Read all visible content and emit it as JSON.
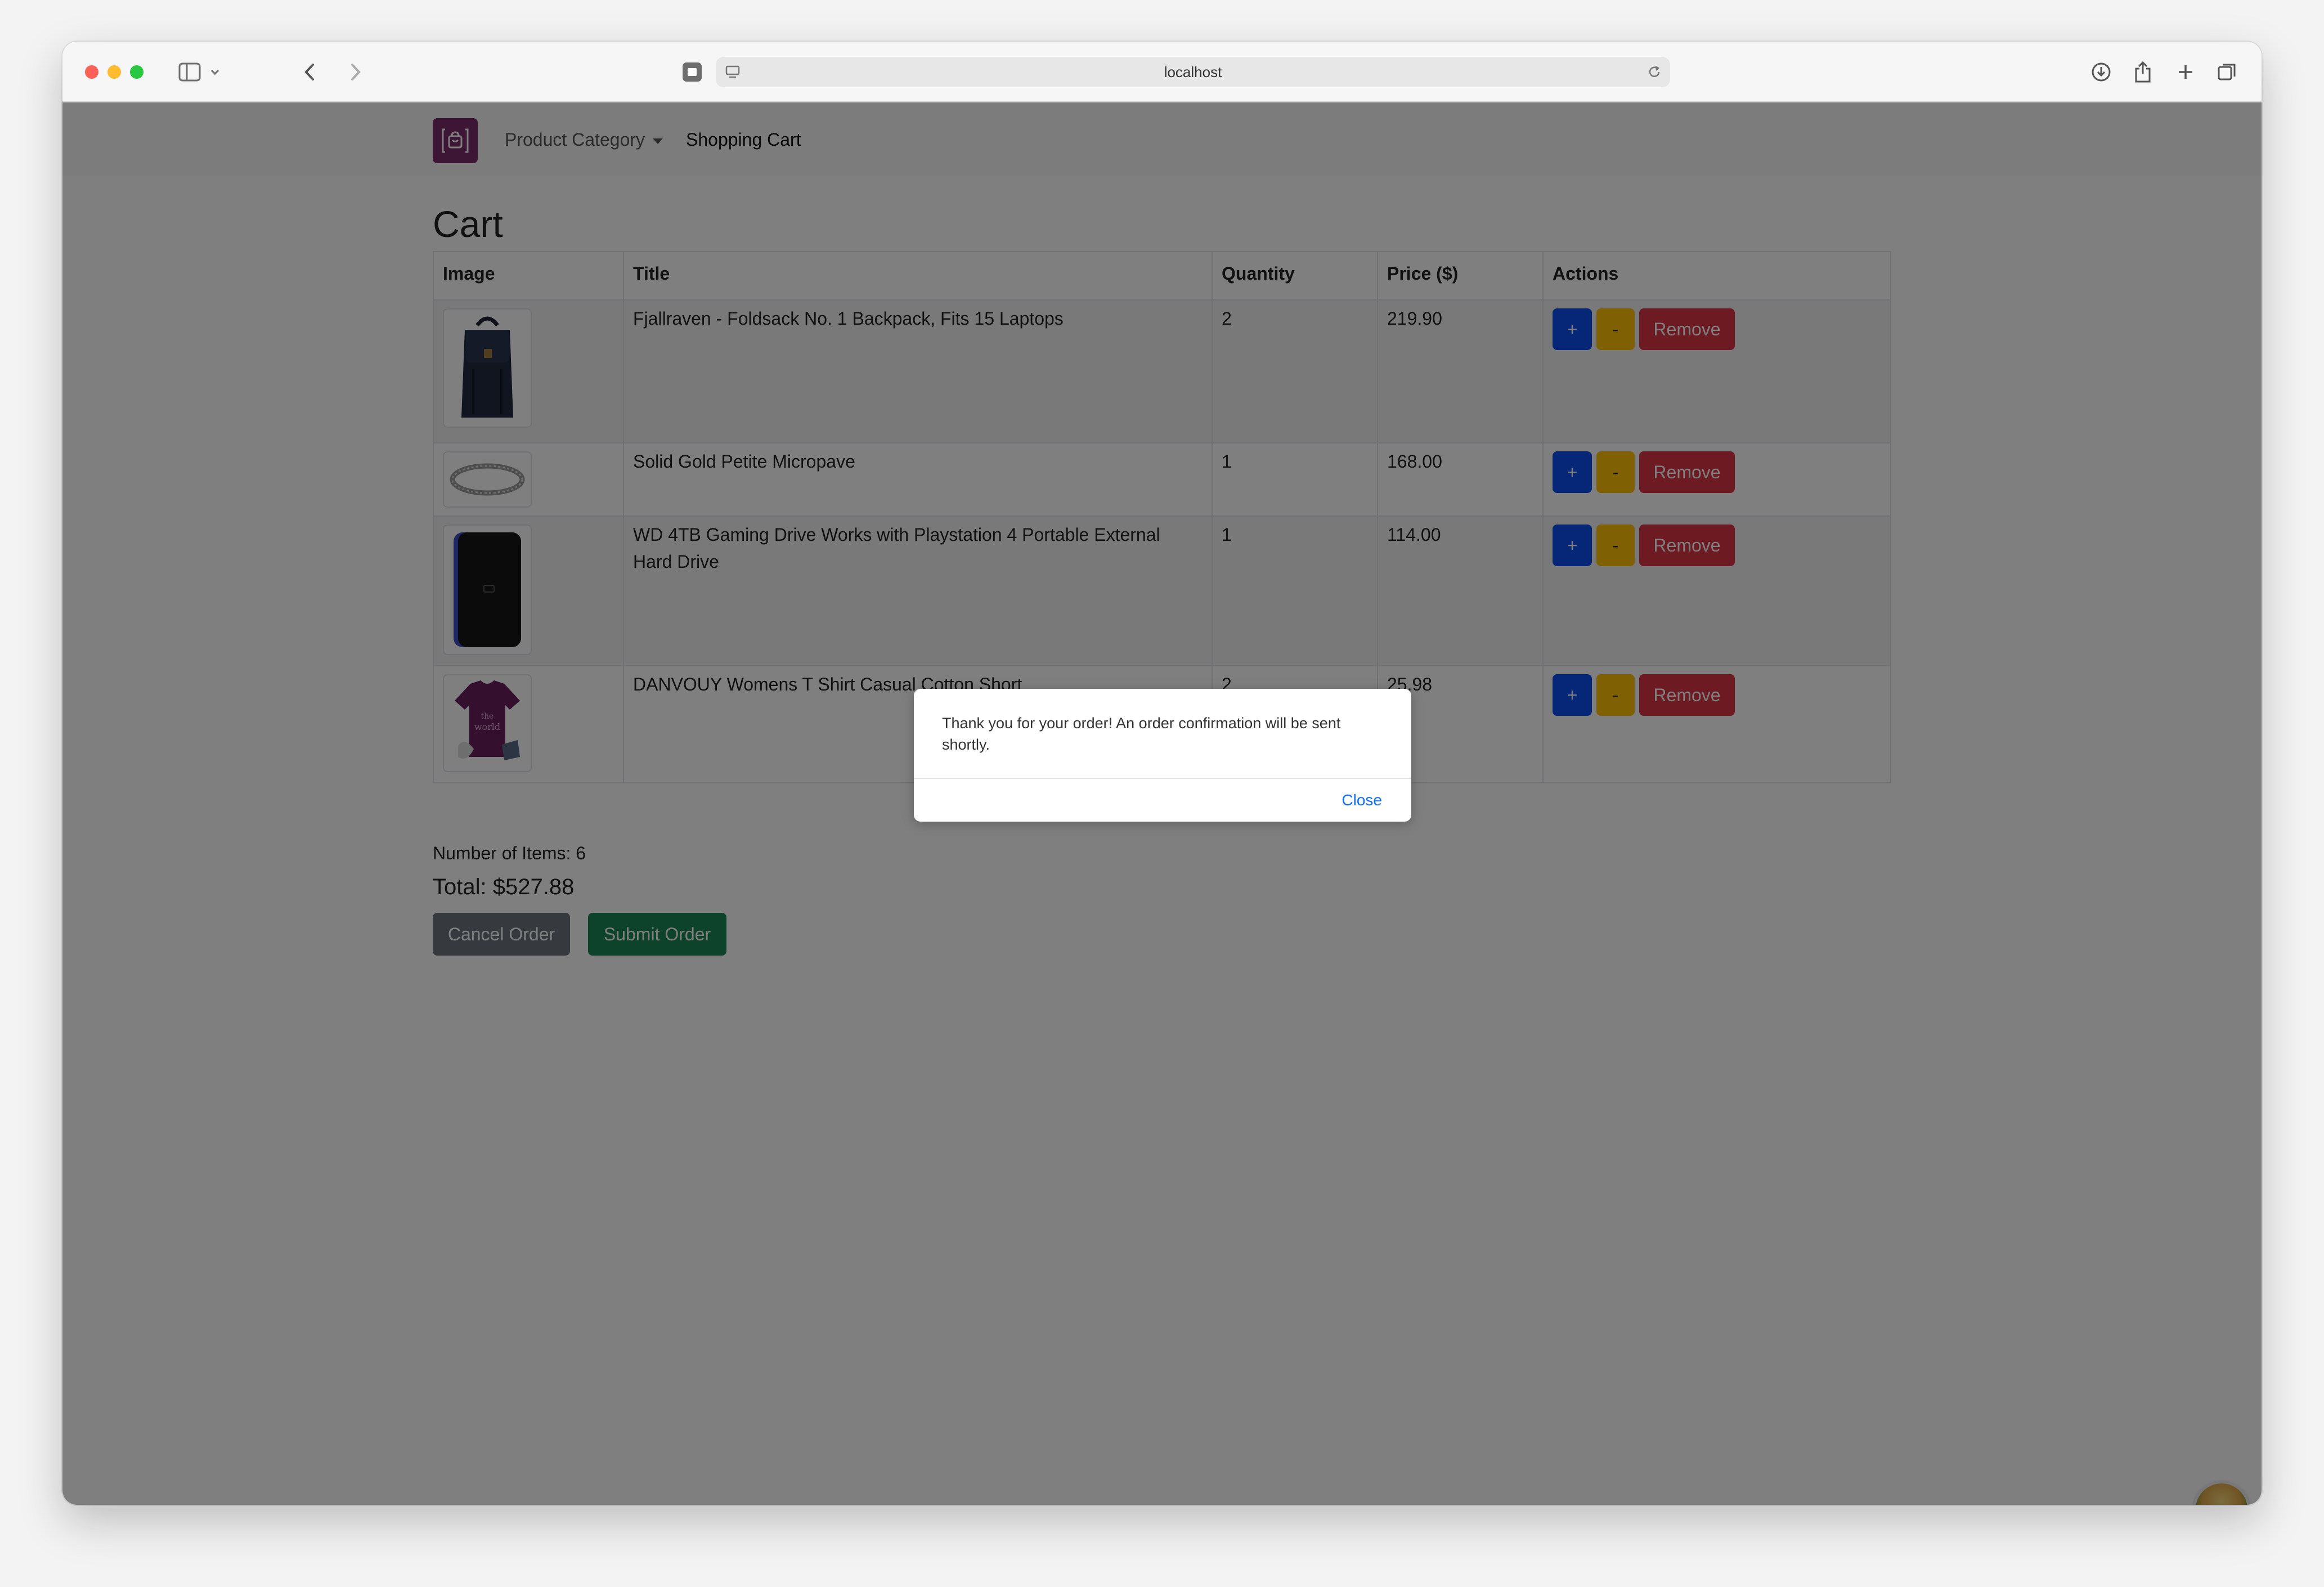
{
  "browser": {
    "url": "localhost"
  },
  "navbar": {
    "category_label": "Product Category",
    "cart_label": "Shopping Cart"
  },
  "cart": {
    "heading": "Cart",
    "columns": [
      "Image",
      "Title",
      "Quantity",
      "Price ($)",
      "Actions"
    ],
    "items": [
      {
        "title": "Fjallraven - Foldsack No. 1 Backpack, Fits 15 Laptops",
        "quantity": "2",
        "price": "219.90",
        "image": "backpack"
      },
      {
        "title": "Solid Gold Petite Micropave",
        "quantity": "1",
        "price": "168.00",
        "image": "bracelet"
      },
      {
        "title": "WD 4TB Gaming Drive Works with Playstation 4 Portable External Hard Drive",
        "quantity": "1",
        "price": "114.00",
        "image": "hard-drive"
      },
      {
        "title": "DANVOUY Womens T Shirt Casual Cotton Short",
        "quantity": "2",
        "price": "25.98",
        "image": "t-shirt"
      }
    ],
    "actions": {
      "plus_label": "+",
      "minus_label": "-",
      "remove_label": "Remove"
    },
    "number_of_items_text": "Number of Items: 6",
    "total_text": "Total: $527.88",
    "cancel_label": "Cancel Order",
    "submit_label": "Submit Order"
  },
  "modal": {
    "message": "Thank you for your order! An order confirmation will be sent shortly.",
    "close_label": "Close"
  },
  "colors": {
    "brand": "#7b2a6a",
    "primary": "#0d4ff0",
    "warning": "#ffc107",
    "danger": "#dc3545",
    "secondary": "#6c757d",
    "success": "#198754",
    "link": "#0d6efd"
  }
}
